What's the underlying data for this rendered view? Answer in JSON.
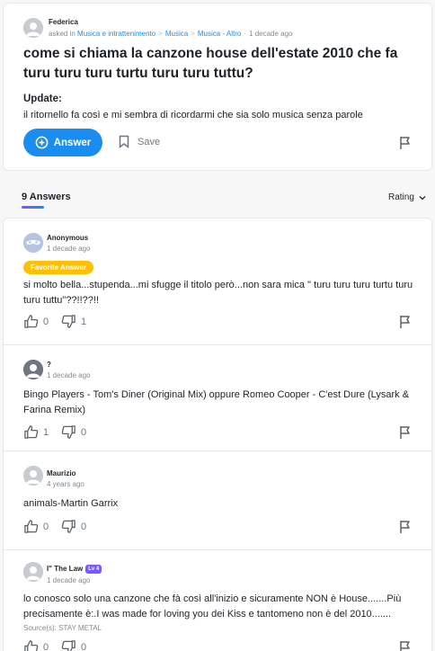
{
  "question": {
    "author": "Federica",
    "asked_in_prefix": "asked in",
    "breadcrumb": [
      "Musica e intrattenimento",
      "Musica",
      "Musica - Altro"
    ],
    "breadcrumb_sep": ">",
    "dot": "·",
    "time": "1 decade ago",
    "title": "come si chiama la canzone house dell'estate 2010 che fa turu turu turu turtu turu turu tuttu?",
    "update_label": "Update:",
    "update_text": "il ritornello fa così e mi sembra di ricordarmi che sia solo musica senza parole",
    "answer_label": "Answer",
    "save_label": "Save"
  },
  "answers_header": {
    "count": "9",
    "label": "Answers",
    "sort_label": "Rating"
  },
  "answers": [
    {
      "author": "Anonymous",
      "time": "1 decade ago",
      "badge": "Favorite Answer",
      "text": "si molto bella...stupenda...mi sfugge il titolo però...non sara mica \" turu turu turu turtu turu turu tuttu\"??!!??!!",
      "likes": "0",
      "dislikes": "1"
    },
    {
      "author": "?",
      "time": "1 decade ago",
      "text": "Bingo Players - Tom's Diner (Original Mix) oppure Romeo Cooper - C'est Dure (Lysark & Farina Remix)",
      "likes": "1",
      "dislikes": "0"
    },
    {
      "author": "Maurizio",
      "time": "4 years ago",
      "text": "animals-Martin Garrix",
      "likes": "0",
      "dislikes": "0"
    },
    {
      "author": "I\" The Law",
      "level": "Lv 4",
      "time": "1 decade ago",
      "text": "lo conosco solo una canzone che fà così all'inizio e sicuramente NON è House.......Più precisamente è:.I was made for loving you dei Kiss e tantomeno non è del 2010.......",
      "source": "Source(s): STAY METAL",
      "likes": "0",
      "dislikes": "0"
    }
  ],
  "colors": {
    "accent": "#1a8ef0",
    "badge": "#ffc000",
    "level": "#7759ff",
    "muted": "#828b92"
  },
  "icons": [
    "user-avatar-icon",
    "anonymous-mask-icon",
    "plus-circle-icon",
    "bookmark-icon",
    "flag-icon",
    "thumbs-up-icon",
    "thumbs-down-icon",
    "chevron-down-icon"
  ]
}
